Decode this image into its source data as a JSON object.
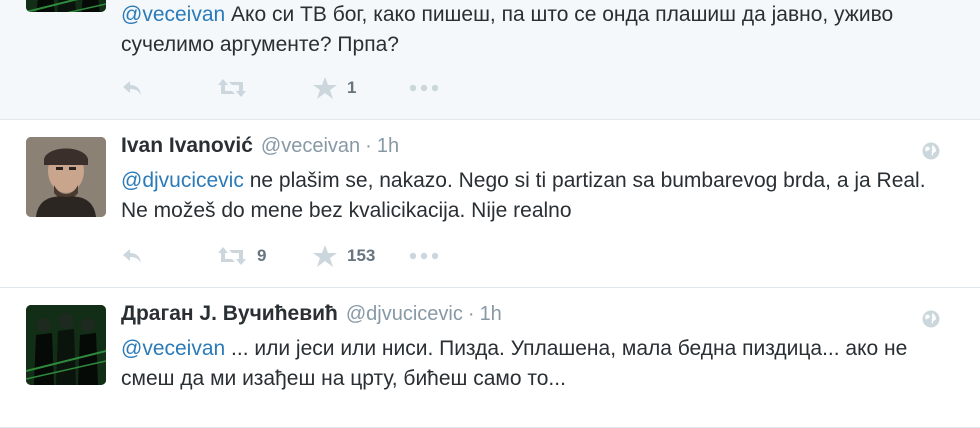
{
  "tweets": [
    {
      "mention": "@veceivan",
      "text": " Ако си ТВ бог, како пишеш, па што се онда плашиш да јавно, уживо сучелимо аргументе? Прпа?",
      "retweets": "",
      "favorites": "1"
    },
    {
      "fullname": "Ivan Ivanović",
      "username": "@veceivan",
      "time": "1h",
      "mention": "@djvucicevic",
      "text": " ne plašim se, nakazo. Nego si ti partizan sa bumbarevog brda, a ja Real. Ne možeš do mene bez kvalicikacija. Nije realno",
      "retweets": "9",
      "favorites": "153"
    },
    {
      "fullname": "Драган Ј. Вучићевић",
      "username": "@djvucicevic",
      "time": "1h",
      "mention": "@veceivan",
      "text": " ... или јеси или ниси. Пизда. Уплашена, мала бедна пизд​ица... ако не смеш да ми изађеш на црту, бићеш само то..."
    }
  ],
  "separator": "·",
  "icons": {
    "reply": "reply-icon",
    "retweet": "retweet-icon",
    "favorite": "star-icon",
    "more": "more-icon",
    "globe": "globe-icon"
  },
  "colors": {
    "mention": "#2b7bb9",
    "action_icon": "#ccd6dd",
    "meta": "#8899a6",
    "hover_bg": "#f5f8fa"
  }
}
